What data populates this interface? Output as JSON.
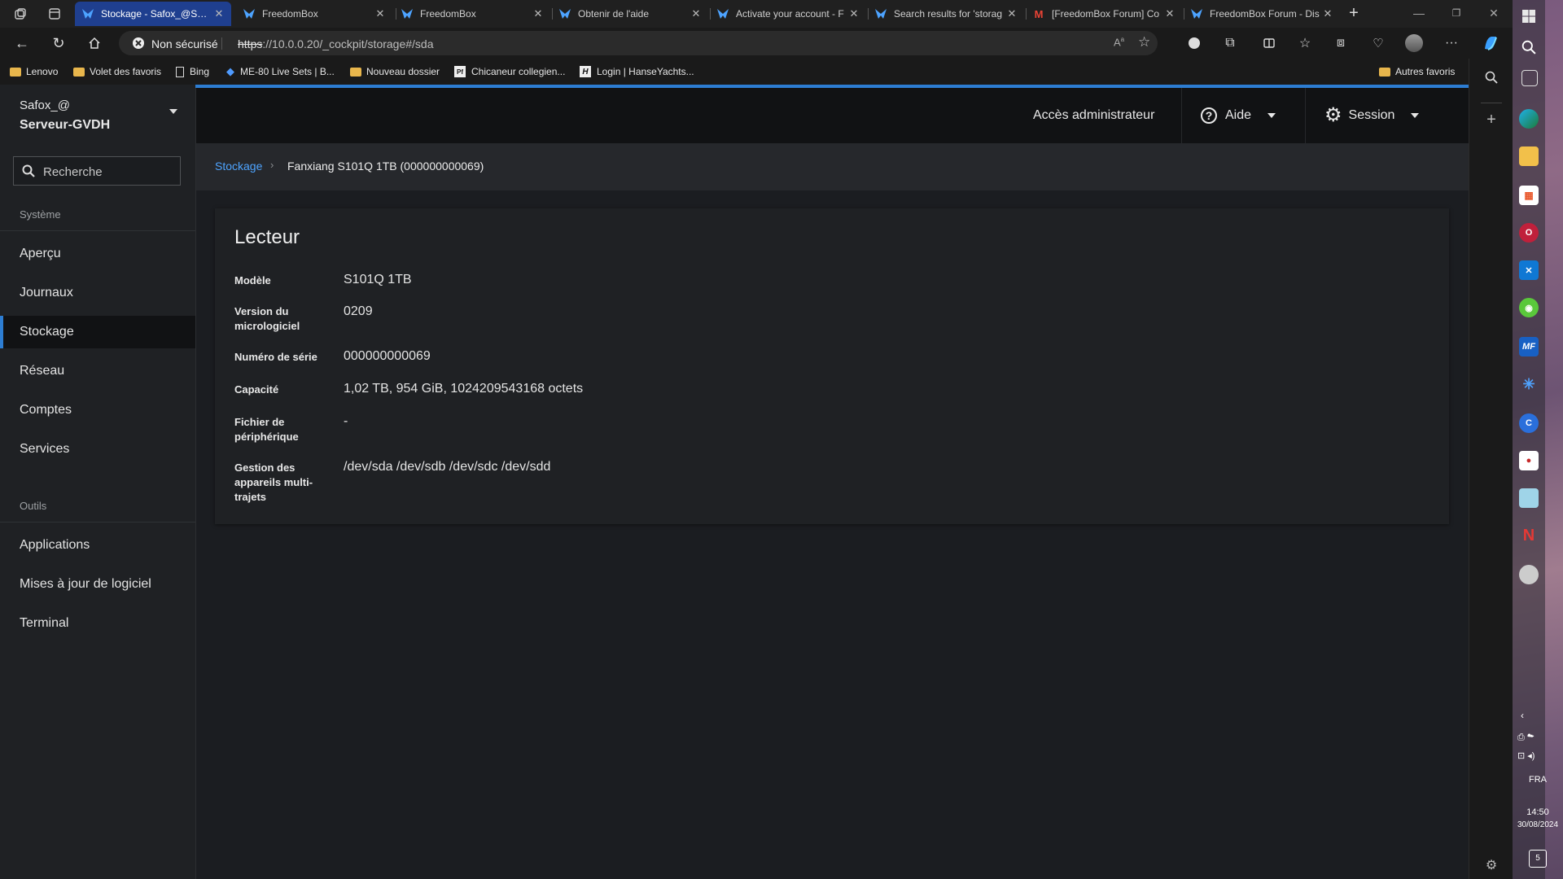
{
  "browser": {
    "tabs": [
      {
        "title": "Stockage - Safox_@Serve",
        "active": true
      },
      {
        "title": "FreedomBox"
      },
      {
        "title": "FreedomBox"
      },
      {
        "title": "Obtenir de l'aide"
      },
      {
        "title": "Activate your account - F"
      },
      {
        "title": "Search results for 'storag"
      },
      {
        "title": "[FreedomBox Forum] Co"
      },
      {
        "title": "FreedomBox Forum - Dis"
      }
    ],
    "security_label": "Non sécurisé",
    "url_scheme": "https",
    "url_rest": "://10.0.0.20/_cockpit/storage#/sda",
    "bookmarks": [
      {
        "label": "Lenovo",
        "icon": "folder-icon"
      },
      {
        "label": "Volet des favoris",
        "icon": "folder-icon"
      },
      {
        "label": "Bing",
        "icon": "page-icon"
      },
      {
        "label": "ME-80 Live Sets | B...",
        "icon": "site-icon"
      },
      {
        "label": "Nouveau dossier",
        "icon": "folder-icon"
      },
      {
        "label": "Chicaneur collegien...",
        "icon": "site-icon"
      },
      {
        "label": "Login | HanseYachts...",
        "icon": "site-icon"
      }
    ],
    "other_favorites": "Autres favoris"
  },
  "sidebar": {
    "host_user": "Safox_@",
    "host_name": "Serveur-GVDH",
    "search_placeholder": "Recherche",
    "section_system": "Système",
    "system_items": [
      "Aperçu",
      "Journaux",
      "Stockage",
      "Réseau",
      "Comptes",
      "Services"
    ],
    "active_item": "Stockage",
    "section_tools": "Outils",
    "tool_items": [
      "Applications",
      "Mises à jour de logiciel",
      "Terminal"
    ]
  },
  "topbar": {
    "admin_access": "Accès administrateur",
    "help": "Aide",
    "session": "Session"
  },
  "breadcrumb": {
    "parent": "Stockage",
    "current": "Fanxiang S101Q 1TB (000000000069)"
  },
  "drive": {
    "title": "Lecteur",
    "fields": [
      {
        "label": "Modèle",
        "value": "S101Q 1TB"
      },
      {
        "label": "Version du micrologiciel",
        "value": "0209"
      },
      {
        "label": "Numéro de série",
        "value": "000000000069"
      },
      {
        "label": "Capacité",
        "value": "1,02 TB, 954 GiB, 1024209543168 octets"
      },
      {
        "label": "Fichier de périphérique",
        "value": "-"
      },
      {
        "label": "Gestion des appareils multi-trajets",
        "value": "/dev/sda /dev/sdb /dev/sdc /dev/sdd"
      }
    ]
  },
  "taskbar": {
    "language": "FRA",
    "time": "14:50",
    "date": "30/08/2024",
    "notifications": "5"
  },
  "colors": {
    "accent": "#2d7dd2",
    "active_tab": "#1f3f8f",
    "folder": "#e8b64c"
  }
}
